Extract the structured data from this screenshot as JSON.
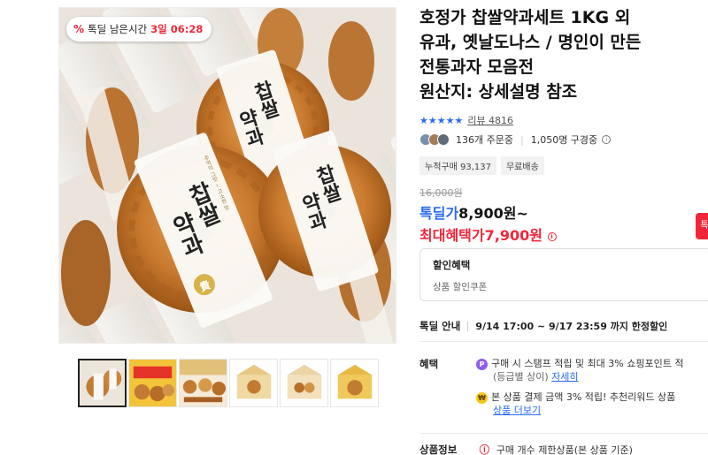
{
  "timer": {
    "prefix": "%",
    "label": "톡딜 남은시간",
    "time": "3일 06:28"
  },
  "product": {
    "title_lines": [
      "호정가 찹쌀약과세트 1KG 외",
      "유과, 옛날도나스 / 명인이 만든",
      "전통과자 모음전",
      "원산지: 상세설명 참조"
    ],
    "package_text_1": "찹쌀",
    "package_text_2": "약과",
    "package_text_small": "추억의 그맛 ~ 고소한 맛",
    "seal_char": "貴"
  },
  "rating": {
    "stars": "★★★★★",
    "review_label": "리뷰 4816"
  },
  "social": {
    "ordering": "136개 주문중",
    "watching": "1,050명 구경중"
  },
  "tags": [
    "누적구매 93,137",
    "무료배송"
  ],
  "price": {
    "original": "16,000원",
    "deal_label": "톡딜가",
    "deal_value": "8,900원~",
    "max_label": "최대혜택가",
    "max_value": "7,900원"
  },
  "discount": {
    "heading": "할인혜택",
    "sub": "상품 할인쿠폰"
  },
  "deal_info": {
    "label": "톡딜 안내",
    "value": "9/14 17:00 ~ 9/17 23:59 까지 한정할인"
  },
  "benefit": {
    "label": "혜택",
    "line1": "구매 시 스탬프 적립 및 최대 3% 쇼핑포인트 적",
    "line1_sub": "(등급별 상이)",
    "line1_link": "자세히",
    "line2": "본 상품 결제 금액 3% 적립! 추천리워드 상품",
    "line2_link": "상품 더보기"
  },
  "product_info": {
    "label": "상품정보",
    "value": "구매 개수 제한상품(본 상품 기준)"
  },
  "side_button": "톡",
  "colors": {
    "accent_red": "#f0273a",
    "accent_blue": "#2a6bf2"
  }
}
